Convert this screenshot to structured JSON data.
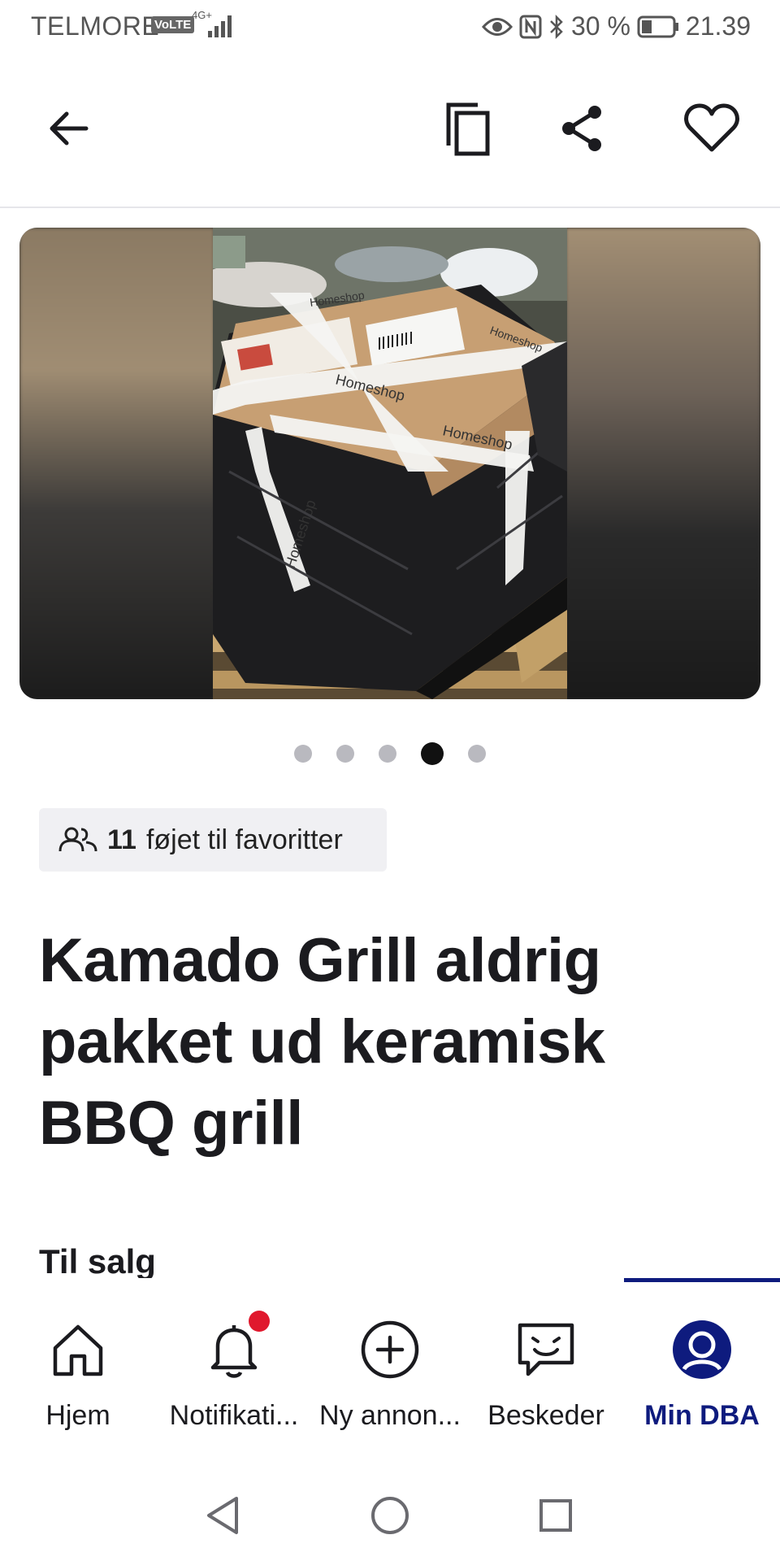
{
  "status_bar": {
    "carrier": "TELMORE",
    "volte": "VoLTE",
    "network": "4G+",
    "battery": "30 %",
    "time": "21.39"
  },
  "top_bar": {
    "icons": [
      "back-arrow-icon",
      "copy-icon",
      "share-icon",
      "heart-icon"
    ]
  },
  "gallery": {
    "total_images": 5,
    "active_index": 4,
    "tape_text": "Homeshop"
  },
  "favorites": {
    "count": "11",
    "text": "føjet til favoritter"
  },
  "listing": {
    "title": "Kamado Grill aldrig pakket ud keramisk BBQ grill",
    "status": "Til salg"
  },
  "bottom_nav": {
    "items": [
      {
        "label": "Hjem",
        "icon": "home-icon"
      },
      {
        "label": "Notifikati...",
        "icon": "bell-icon"
      },
      {
        "label": "Ny annon...",
        "icon": "add-circle-icon"
      },
      {
        "label": "Beskeder",
        "icon": "message-icon"
      },
      {
        "label": "Min DBA",
        "icon": "profile-icon"
      }
    ],
    "active": "Min DBA"
  },
  "colors": {
    "accent": "#0e1b7e",
    "notification": "#e0182d",
    "chip_bg": "#f0f0f3"
  }
}
